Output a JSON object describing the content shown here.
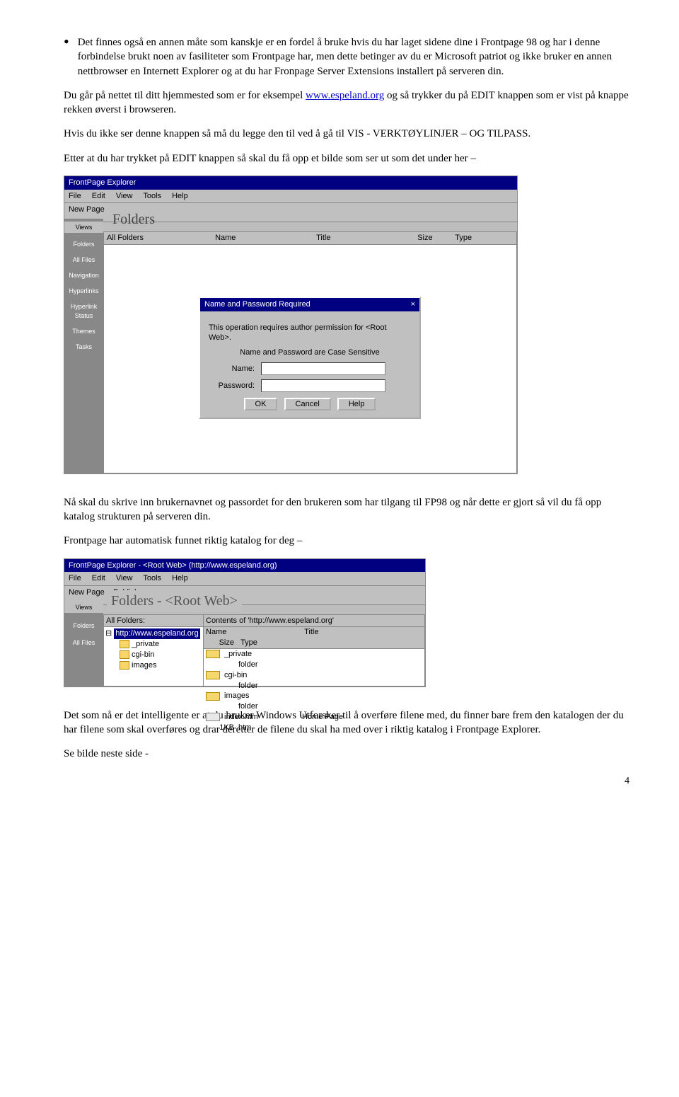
{
  "para1": "Det finnes også en annen måte som kanskje er en fordel å bruke hvis du har laget sidene dine i Frontpage 98 og har i denne forbindelse brukt noen av fasiliteter som Frontpage har, men dette betinger av du er Microsoft patriot og ikke bruker en annen nettbrowser en Internett Explorer og at du har Fronpage Server Extensions installert på serveren din.",
  "para2a": "Du går på nettet til ditt hjemmested som er for eksempel ",
  "para2_link": "www.espeland.org",
  "para2b": " og så trykker du på EDIT knappen som er vist på knappe rekken øverst i browseren.",
  "para3": "Hvis du ikke ser denne knappen så må du legge den til ved å gå til VIS - VERKTØYLINJER – OG TILPASS.",
  "para4": "Etter at du har trykket på EDIT knappen så skal du få opp et bilde som ser ut som det under her –",
  "para5": "Nå skal du skrive inn brukernavnet og passordet for den brukeren som har tilgang til FP98 og når dette er gjort så vil du få opp katalog strukturen på serveren din.",
  "para6": "Frontpage har automatisk funnet riktig katalog for deg –",
  "para7": "Det som nå er det intelligente er at du bruker Windows Utforsker til å overføre filene med, du finner bare frem den katalogen der du har filene som skal overføres og drar deretter de filene du skal ha med over i riktig katalog i Frontpage Explorer.",
  "para8": "Se bilde neste side -",
  "page_num": "4",
  "s1": {
    "title": "FrontPage Explorer",
    "menu": {
      "file": "File",
      "edit": "Edit",
      "view": "View",
      "tools": "Tools",
      "help": "Help"
    },
    "newpage": "New Page",
    "views": "Views",
    "side": {
      "folders": "Folders",
      "allfiles": "All Files",
      "nav": "Navigation",
      "hyper": "Hyperlinks",
      "hstatus": "Hyperlink Status",
      "themes": "Themes",
      "tasks": "Tasks"
    },
    "folders_hdr": "Folders",
    "allfolders": "All Folders",
    "cols": {
      "name": "Name",
      "title": "Title",
      "size": "Size",
      "type": "Type"
    },
    "dlg": {
      "title": "Name and Password Required",
      "close": "×",
      "line1": "This operation requires author permission for <Root Web>.",
      "line2": "Name and Password are Case Sensitive",
      "name": "Name:",
      "pass": "Password:",
      "ok": "OK",
      "cancel": "Cancel",
      "help": "Help"
    }
  },
  "s2": {
    "title": "FrontPage Explorer - <Root Web> (http://www.espeland.org)",
    "menu": {
      "file": "File",
      "edit": "Edit",
      "view": "View",
      "tools": "Tools",
      "help": "Help"
    },
    "newpage": "New Page",
    "publish": "Publish",
    "views": "Views",
    "folders_hdr": "Folders - <Root Web>",
    "side": {
      "folders": "Folders",
      "allfiles": "All Files"
    },
    "tree": {
      "hdr": "All Folders:",
      "root": "http://www.espeland.org",
      "c1": "_private",
      "c2": "cgi-bin",
      "c3": "images"
    },
    "list": {
      "hdr": "Contents of 'http://www.espeland.org'",
      "cols": {
        "name": "Name",
        "title": "Title",
        "size": "Size",
        "type": "Type"
      },
      "rows": [
        {
          "name": "_private",
          "title": "",
          "size": "",
          "type": "folder"
        },
        {
          "name": "cgi-bin",
          "title": "",
          "size": "",
          "type": "folder"
        },
        {
          "name": "images",
          "title": "",
          "size": "",
          "type": "folder"
        },
        {
          "name": "index.htm",
          "title": "Home Page",
          "size": "1KB",
          "type": "htm"
        }
      ]
    }
  }
}
